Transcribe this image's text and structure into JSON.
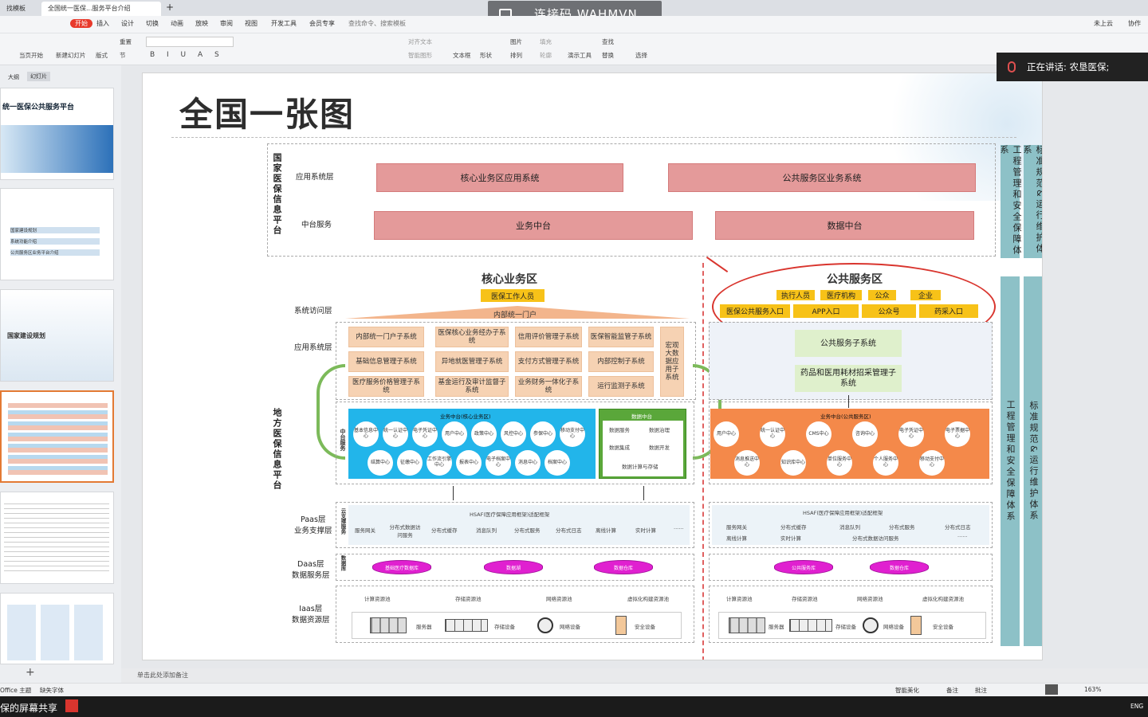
{
  "titlebar": {
    "tab1": "找模板",
    "tab2": "全国统一医保...服务平台介绍",
    "add": "+"
  },
  "connection": {
    "label": "连接码 WAHMVN"
  },
  "menubar": {
    "items": [
      "开始",
      "插入",
      "设计",
      "切换",
      "动画",
      "放映",
      "审阅",
      "视图",
      "开发工具",
      "会员专享"
    ],
    "search": "查找命令、搜索模板",
    "right1": "未上云",
    "right2": "协作"
  },
  "ribbon": {
    "items": [
      "当页开始",
      "新建幻灯片",
      "版式",
      "节",
      "重置",
      "文本框",
      "形状",
      "图片",
      "排列",
      "演示工具",
      "查找",
      "替换",
      "选择",
      "对齐文本",
      "智能图形",
      "填充",
      "轮廓",
      "排列"
    ]
  },
  "leftpanel": {
    "tab_outline": "大纲",
    "tab_slides": "幻灯片",
    "add": "+",
    "slide1_title": "统一医保公共服务平台",
    "slide2_items": [
      "国家建设规划",
      "系统功能介绍",
      "公共服务区业务平台介绍"
    ],
    "slide3_title": "国家建设规划"
  },
  "slide": {
    "title": "全国一张图",
    "national_label": "国家医保信息平台",
    "local_label": "地方医保信息平台",
    "layers": {
      "app": "应用系统层",
      "mid": "中台服务",
      "access": "系统访问层",
      "app2": "应用系统层",
      "paas": "Paas层\n业务支撑层",
      "daas": "Daas层\n数据服务层",
      "iaas": "Iaas层\n数据资源层"
    },
    "national": {
      "core_app": "核心业务区应用系统",
      "public_app": "公共服务区业务系统",
      "biz_mid": "业务中台",
      "data_mid": "数据中台"
    },
    "core": {
      "title": "核心业务区",
      "staff": "医保工作人员",
      "portal": "内部统一门户",
      "systems": [
        "内部统一门户子系统",
        "医保核心业务经办子系统",
        "信用评价管理子系统",
        "医保智能监管子系统",
        "基础信息管理子系统",
        "异地就医管理子系统",
        "支付方式管理子系统",
        "内部控制子系统",
        "医疗服务价格管理子系统",
        "基金运行及审计监督子系统",
        "业务财务一体化子系统",
        "运行监测子系统"
      ],
      "macro": "宏观大数据应用子系统",
      "mid_title": "业务中台(核心业务区)",
      "mid_vlabel": "中台服务",
      "circles": [
        "基本信息中心",
        "统一认证中心",
        "电子凭证中心",
        "用户中心",
        "政策中心",
        "风控中心",
        "参保中心",
        "移动支付中心",
        "结算中心",
        "征缴中心",
        "工作流引擎中心",
        "报表中心",
        "电子档案中心",
        "消息中心",
        "档案中心"
      ],
      "data_mid_title": "数据中台",
      "data_items": [
        "数据服务",
        "数据治理",
        "数据集成",
        "数据开发",
        "数据计算与存储"
      ]
    },
    "public": {
      "title": "公共服务区",
      "actors": [
        "执行人员",
        "医疗机构",
        "公众",
        "企业"
      ],
      "entries": [
        "医保公共服务入口",
        "APP入口",
        "公众号",
        "药采入口"
      ],
      "sub1": "公共服务子系统",
      "sub2": "药品和医用耗材招采管理子系统",
      "mid_title": "业务中台(公共服务区)",
      "circles": [
        "用户中心",
        "统一认证中心",
        "CMS中心",
        "咨询中心",
        "电子凭证中心",
        "电子票据中心",
        "消息推送中心",
        "知识库中心",
        "单位服务中心",
        "个人服务中心",
        "移动支付中心"
      ]
    },
    "paas": {
      "core_title": "HSAF(医疗保障应用框架)适配框架",
      "core_items": [
        "服务网关",
        "分布式数据访问服务",
        "分布式缓存",
        "消息队列",
        "分布式服务",
        "分布式日志",
        "离线计算",
        "实时计算",
        "......"
      ],
      "core_vlabel": "云支撑服务",
      "pub_title": "HSAF(医疗保障应用框架)适配框架",
      "pub_items": [
        "服务网关",
        "分布式缓存",
        "消息队列",
        "分布式服务",
        "分布式日志",
        "离线计算",
        "实时计算",
        "分布式数据访问服务",
        "......"
      ]
    },
    "daas": {
      "core": [
        "基础医疗数据库",
        "数据湖",
        "数据仓库"
      ],
      "core_vlabel": "数据库",
      "pub": [
        "公共服务库",
        "数据仓库"
      ]
    },
    "iaas": {
      "core_pools": [
        "计算资源池",
        "存储资源池",
        "网络资源池",
        "虚拟化构建资源池"
      ],
      "core_devices": [
        "服务器",
        "存储设备",
        "网络设备",
        "安全设备"
      ],
      "pub_pools": [
        "计算资源池",
        "存储资源池",
        "网络资源池",
        "虚拟化构建资源池"
      ],
      "pub_devices": [
        "服务器",
        "存储设备",
        "网络设备",
        "安全设备"
      ]
    },
    "side": {
      "eng": "工程管理和安全保障体系",
      "std": "标准规范&运行维护体系"
    }
  },
  "notes": "单击此处添加备注",
  "status": {
    "theme": "Office 主题",
    "font": "缺失字体",
    "smart": "智能美化",
    "notes": "备注",
    "comment": "批注",
    "zoom": "163%"
  },
  "speaking": {
    "text": "正在讲话: 农垦医保;"
  },
  "taskbar": {
    "share": "保的屏幕共享",
    "lang": "ENG"
  }
}
